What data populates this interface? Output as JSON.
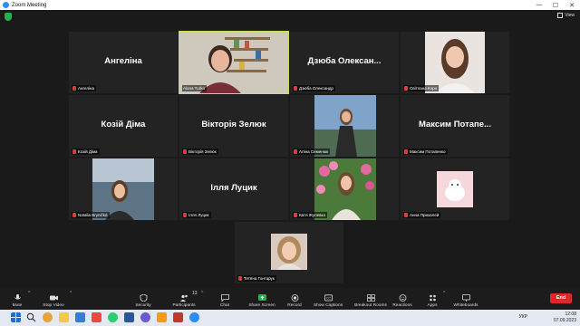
{
  "window": {
    "title": "Zoom Meeting"
  },
  "topbar": {
    "view_label": "View"
  },
  "tiles": [
    {
      "name": "Ангеліна",
      "label": "Ангеліна"
    },
    {
      "name": "Alona Turko",
      "label": "Alona Turko"
    },
    {
      "name": "Дзюба Олексан...",
      "label": "Дзюба Олександр"
    },
    {
      "name": "Світлана Ko...",
      "label": "Світлана Корн"
    },
    {
      "name": "Козій Діма",
      "label": "Козій Діма"
    },
    {
      "name": "Вікторія Зелюк",
      "label": "Вікторія Зелюк"
    },
    {
      "name": "Аліна Семенюк",
      "label": "Аліна Семенюк"
    },
    {
      "name": "Максим Потапе...",
      "label": "Максим Потапенко"
    },
    {
      "name": "Natalia Bryničká",
      "label": "Natalia Bryničká"
    },
    {
      "name": "Ілля Луцик",
      "label": "Ілля Луцик"
    },
    {
      "name": "Катя Жулевко",
      "label": "Катя Жулевко"
    },
    {
      "name": "Анна Прихалей",
      "label": "Анна Прихалей"
    },
    {
      "name": "Тетяна Гонтарук",
      "label": "Тетяна Гонтарук"
    }
  ],
  "toolbar": {
    "mute": "Mute",
    "stop_video": "Stop Video",
    "security": "Security",
    "participants": "Participants",
    "participants_count": "13",
    "chat": "Chat",
    "share_screen": "Share Screen",
    "record": "Record",
    "show_captions": "Show Captions",
    "breakout_rooms": "Breakout Rooms",
    "reactions": "Reactions",
    "apps": "Apps",
    "whiteboards": "Whiteboards",
    "end": "End"
  },
  "taskbar": {
    "language": "УКР",
    "time": "12:08",
    "date": "07.09.2023"
  },
  "colors": {
    "active_speaker": "#c8e04b",
    "share_screen": "#23b14d",
    "end_button": "#e02828",
    "muted": "#e0393e"
  }
}
